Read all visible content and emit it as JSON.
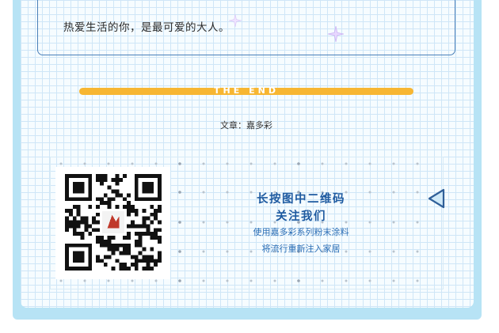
{
  "quote": {
    "text": "热爱生活的你，是最可爱的大人。"
  },
  "divider": {
    "text": "THE END"
  },
  "credit": {
    "label": "文章：嘉多彩"
  },
  "qr": {
    "title_line1": "长按图中二维码",
    "title_line2": "关注我们",
    "desc_line1": "使用嘉多彩系列粉末涂料",
    "desc_line2": "将流行重新注入家居"
  },
  "colors": {
    "frame": "#b7e3f5",
    "grid_line": "#cfe6f7",
    "accent_yellow": "#f7b632",
    "title_blue": "#1e5aa0",
    "text_blue": "#2a6db5"
  },
  "icons": {
    "sparkle": "four-point-sparkle-icon",
    "arrow": "triangle-left-arrow-icon",
    "logo": "brand-logo-icon"
  }
}
